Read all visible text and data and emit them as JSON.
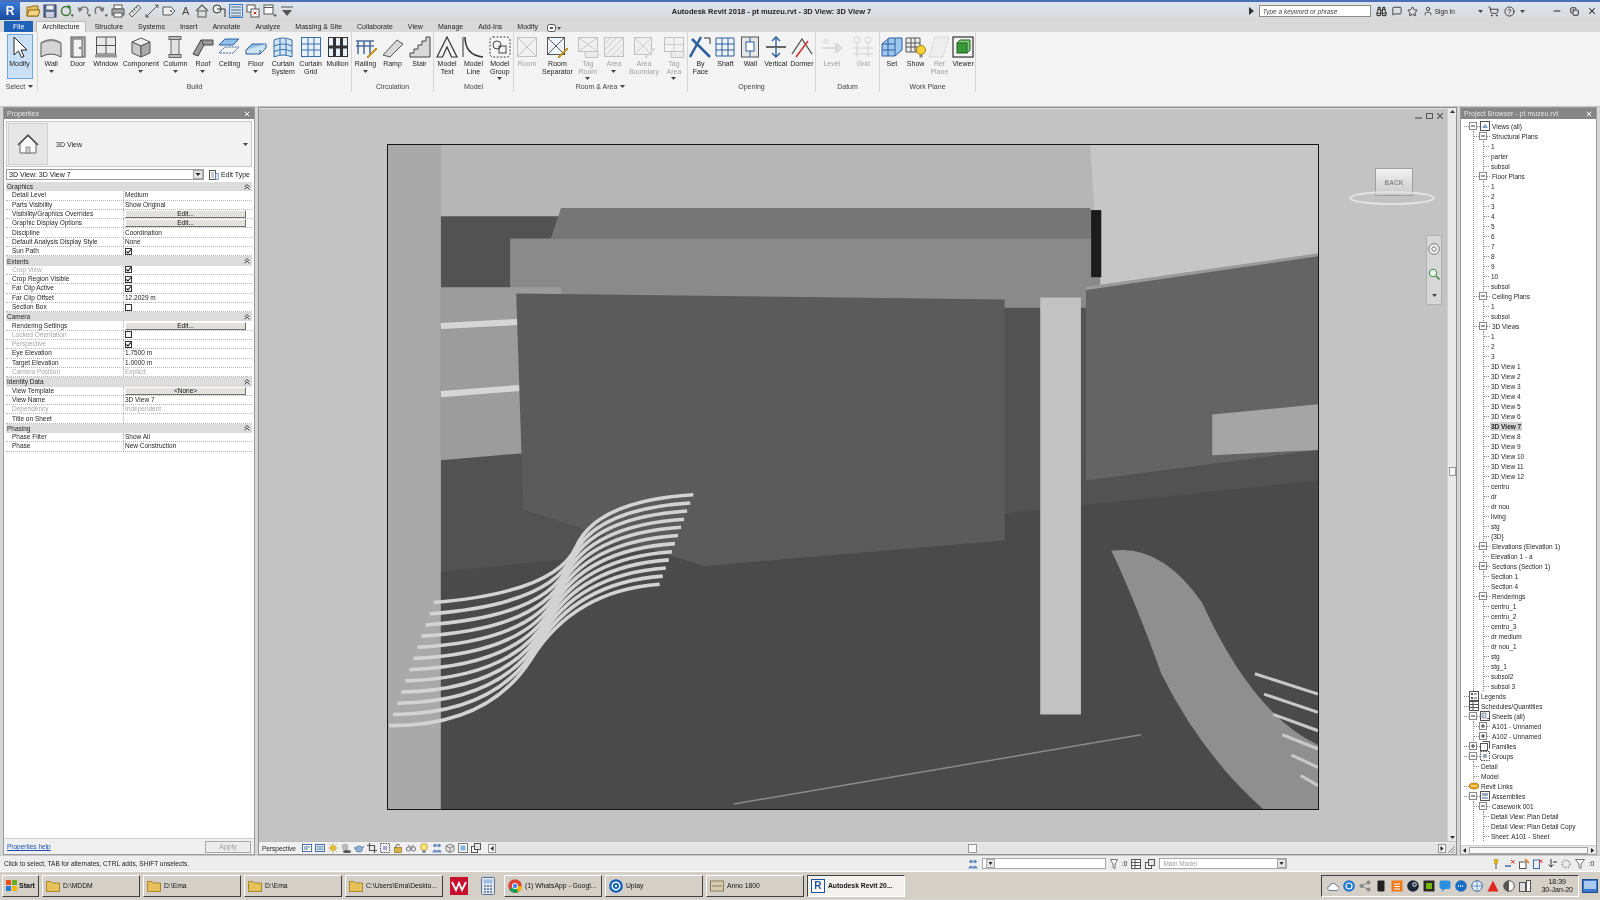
{
  "title_bar": {
    "logo": "R",
    "quick_access": [
      {
        "on": false
      },
      {
        "on": false
      },
      {
        "on": false
      },
      {
        "on": false
      },
      {
        "on": false
      },
      {
        "on": false
      },
      {
        "on": false
      },
      {
        "on": false
      },
      {
        "on": false
      },
      {
        "label": "A",
        "on": false
      },
      {
        "on": false
      },
      {
        "on": false
      },
      {
        "on": true
      },
      {
        "on": false
      },
      {
        "on": false
      },
      {
        "on": false
      }
    ],
    "title": "Autodesk Revit 2018 - pt muzeu.rvt - 3D View: 3D View 7",
    "search": {
      "placeholder": "Type a keyword or phrase"
    },
    "sign_in": "Sign In"
  },
  "ribbon": {
    "tabs": [
      {
        "label": "File",
        "kind": "file",
        "selected": false
      },
      {
        "label": "Architecture",
        "kind": "tab",
        "selected": true
      },
      {
        "label": "Structure",
        "kind": "tab",
        "selected": false
      },
      {
        "label": "Systems",
        "kind": "tab",
        "selected": false
      },
      {
        "label": "Insert",
        "kind": "tab",
        "selected": false
      },
      {
        "label": "Annotate",
        "kind": "tab",
        "selected": false
      },
      {
        "label": "Analyze",
        "kind": "tab",
        "selected": false
      },
      {
        "label": "Massing & Site",
        "kind": "tab",
        "selected": false
      },
      {
        "label": "Collaborate",
        "kind": "tab",
        "selected": false
      },
      {
        "label": "View",
        "kind": "tab",
        "selected": false
      },
      {
        "label": "Manage",
        "kind": "tab",
        "selected": false
      },
      {
        "label": "Add-Ins",
        "kind": "tab",
        "selected": false
      },
      {
        "label": "Modify",
        "kind": "tab",
        "selected": false
      }
    ],
    "panels": [
      {
        "title": "Select",
        "dropdown": true,
        "tools": [
          {
            "label": "Modify",
            "selected": true,
            "disabled": false,
            "dropdown": false
          }
        ]
      },
      {
        "title": "Build",
        "dropdown": false,
        "tools": [
          {
            "label": "Wall",
            "selected": false,
            "disabled": false,
            "dropdown": true
          },
          {
            "label": "Door",
            "selected": false,
            "disabled": false,
            "dropdown": false
          },
          {
            "label": "Window",
            "selected": false,
            "disabled": false,
            "dropdown": false
          },
          {
            "label": "Component",
            "selected": false,
            "disabled": false,
            "dropdown": true
          },
          {
            "label": "Column",
            "selected": false,
            "disabled": false,
            "dropdown": true
          },
          {
            "label": "Roof",
            "selected": false,
            "disabled": false,
            "dropdown": true
          },
          {
            "label": "Ceiling",
            "selected": false,
            "disabled": false,
            "dropdown": false
          },
          {
            "label": "Floor",
            "selected": false,
            "disabled": false,
            "dropdown": true
          },
          {
            "label": "Curtain System",
            "selected": false,
            "disabled": false,
            "dropdown": false
          },
          {
            "label": "Curtain Grid",
            "selected": false,
            "disabled": false,
            "dropdown": false
          },
          {
            "label": "Mullion",
            "selected": false,
            "disabled": false,
            "dropdown": false
          }
        ]
      },
      {
        "title": "Circulation",
        "dropdown": false,
        "tools": [
          {
            "label": "Railing",
            "selected": false,
            "disabled": false,
            "dropdown": true
          },
          {
            "label": "Ramp",
            "selected": false,
            "disabled": false,
            "dropdown": false
          },
          {
            "label": "Stair",
            "selected": false,
            "disabled": false,
            "dropdown": false
          }
        ]
      },
      {
        "title": "Model",
        "dropdown": false,
        "tools": [
          {
            "label": "Model Text",
            "selected": false,
            "disabled": false,
            "dropdown": false
          },
          {
            "label": "Model Line",
            "selected": false,
            "disabled": false,
            "dropdown": false
          },
          {
            "label": "Model Group",
            "selected": false,
            "disabled": false,
            "dropdown": true
          }
        ]
      },
      {
        "title": "Room & Area",
        "dropdown": true,
        "tools": [
          {
            "label": "Room",
            "selected": false,
            "disabled": true,
            "dropdown": false
          },
          {
            "label": "Room Separator",
            "selected": false,
            "disabled": false,
            "dropdown": false
          },
          {
            "label": "Tag Room",
            "selected": false,
            "disabled": true,
            "dropdown": true
          },
          {
            "label": "Area",
            "selected": false,
            "disabled": true,
            "dropdown": true
          },
          {
            "label": "Area Boundary",
            "selected": false,
            "disabled": true,
            "dropdown": false
          },
          {
            "label": "Tag Area",
            "selected": false,
            "disabled": true,
            "dropdown": true
          }
        ]
      },
      {
        "title": "Opening",
        "dropdown": false,
        "tools": [
          {
            "label": "By Face",
            "selected": false,
            "disabled": false,
            "dropdown": false
          },
          {
            "label": "Shaft",
            "selected": false,
            "disabled": false,
            "dropdown": false
          },
          {
            "label": "Wall",
            "selected": false,
            "disabled": false,
            "dropdown": false
          },
          {
            "label": "Vertical",
            "selected": false,
            "disabled": false,
            "dropdown": false
          },
          {
            "label": "Dormer",
            "selected": false,
            "disabled": false,
            "dropdown": false
          }
        ]
      },
      {
        "title": "Datum",
        "dropdown": false,
        "tools": [
          {
            "label": "Level",
            "selected": false,
            "disabled": true,
            "dropdown": false
          },
          {
            "label": "Grid",
            "selected": false,
            "disabled": true,
            "dropdown": false
          }
        ]
      },
      {
        "title": "Work Plane",
        "dropdown": false,
        "tools": [
          {
            "label": "Set",
            "selected": false,
            "disabled": false,
            "dropdown": false
          },
          {
            "label": "Show",
            "selected": false,
            "disabled": false,
            "dropdown": false
          },
          {
            "label": "Ref Plane",
            "selected": false,
            "disabled": true,
            "dropdown": false
          },
          {
            "label": "Viewer",
            "selected": false,
            "disabled": false,
            "dropdown": false
          }
        ]
      }
    ]
  },
  "properties": {
    "title": "Properties",
    "type_name": "3D View",
    "instance": "3D View: 3D View 7",
    "edit_type": "Edit Type",
    "groups": [
      {
        "name": "Graphics",
        "expanded": true,
        "rows": [
          {
            "label": "Detail Level",
            "kind": "text",
            "value": "Medium",
            "disabled": false
          },
          {
            "label": "Parts Visibility",
            "kind": "text",
            "value": "Show Original",
            "disabled": false
          },
          {
            "label": "Visibility/Graphics Overrides",
            "kind": "button",
            "value": "Edit...",
            "disabled": false
          },
          {
            "label": "Graphic Display Options",
            "kind": "button",
            "value": "Edit...",
            "disabled": false
          },
          {
            "label": "Discipline",
            "kind": "text",
            "value": "Coordination",
            "disabled": false
          },
          {
            "label": "Default Analysis Display Style",
            "kind": "text",
            "value": "None",
            "disabled": false
          },
          {
            "label": "Sun Path",
            "kind": "checkbox",
            "checked": true,
            "disabled": false
          }
        ]
      },
      {
        "name": "Extents",
        "expanded": true,
        "rows": [
          {
            "label": "Crop View",
            "kind": "checkbox",
            "checked": true,
            "disabled": true
          },
          {
            "label": "Crop Region Visible",
            "kind": "checkbox",
            "checked": true,
            "disabled": false
          },
          {
            "label": "Far Clip Active",
            "kind": "checkbox",
            "checked": true,
            "disabled": false
          },
          {
            "label": "Far Clip Offset",
            "kind": "text",
            "value": "12.2029 m",
            "disabled": false
          },
          {
            "label": "Section Box",
            "kind": "checkbox",
            "checked": false,
            "disabled": false
          }
        ]
      },
      {
        "name": "Camera",
        "expanded": true,
        "rows": [
          {
            "label": "Rendering Settings",
            "kind": "button",
            "value": "Edit...",
            "disabled": false
          },
          {
            "label": "Locked Orientation",
            "kind": "checkbox",
            "checked": false,
            "disabled": true
          },
          {
            "label": "Perspective",
            "kind": "checkbox",
            "checked": true,
            "disabled": true
          },
          {
            "label": "Eye Elevation",
            "kind": "text",
            "value": "1.7500 m",
            "disabled": false
          },
          {
            "label": "Target Elevation",
            "kind": "text",
            "value": "1.0000 m",
            "disabled": false
          },
          {
            "label": "Camera Position",
            "kind": "text",
            "value": "Explicit",
            "disabled": true
          }
        ]
      },
      {
        "name": "Identity Data",
        "expanded": true,
        "rows": [
          {
            "label": "View Template",
            "kind": "button",
            "value": "<None>",
            "disabled": false
          },
          {
            "label": "View Name",
            "kind": "text",
            "value": "3D View 7",
            "disabled": false
          },
          {
            "label": "Dependency",
            "kind": "text",
            "value": "Independent",
            "disabled": true
          },
          {
            "label": "Title on Sheet",
            "kind": "text",
            "disabled": false
          }
        ]
      },
      {
        "name": "Phasing",
        "expanded": true,
        "rows": [
          {
            "label": "Phase Filter",
            "kind": "text",
            "value": "Show All",
            "disabled": false
          },
          {
            "label": "Phase",
            "kind": "text",
            "value": "New Construction",
            "disabled": false
          }
        ]
      }
    ],
    "help": "Properties help",
    "apply": {
      "label": "Apply",
      "disabled": true
    }
  },
  "view": {
    "view_cube": "BACK",
    "scale": "Perspective"
  },
  "project_browser": {
    "title": "Project Browser - pt muzeu.rvt",
    "tree": [
      {
        "label": "Views (all)",
        "expanded": true,
        "selected": false,
        "children": [
          {
            "label": "Structural Plans",
            "expanded": true,
            "selected": false,
            "children": [
              {
                "label": "1",
                "selected": false
              },
              {
                "label": "parter",
                "selected": false
              },
              {
                "label": "subsol",
                "selected": false
              }
            ]
          },
          {
            "label": "Floor Plans",
            "expanded": true,
            "selected": false,
            "children": [
              {
                "label": "1",
                "selected": false
              },
              {
                "label": "2",
                "selected": false
              },
              {
                "label": "3",
                "selected": false
              },
              {
                "label": "4",
                "selected": false
              },
              {
                "label": "5",
                "selected": false
              },
              {
                "label": "6",
                "selected": false
              },
              {
                "label": "7",
                "selected": false
              },
              {
                "label": "8",
                "selected": false
              },
              {
                "label": "9",
                "selected": false
              },
              {
                "label": "10",
                "selected": false
              },
              {
                "label": "subsol",
                "selected": false
              }
            ]
          },
          {
            "label": "Ceiling Plans",
            "expanded": true,
            "selected": false,
            "children": [
              {
                "label": "1",
                "selected": false
              },
              {
                "label": "subsol",
                "selected": false
              }
            ]
          },
          {
            "label": "3D Views",
            "expanded": true,
            "selected": false,
            "children": [
              {
                "label": "1",
                "selected": false
              },
              {
                "label": "2",
                "selected": false
              },
              {
                "label": "3",
                "selected": false
              },
              {
                "label": "3D View 1",
                "selected": false
              },
              {
                "label": "3D View 2",
                "selected": false
              },
              {
                "label": "3D View 3",
                "selected": false
              },
              {
                "label": "3D View 4",
                "selected": false
              },
              {
                "label": "3D View 5",
                "selected": false
              },
              {
                "label": "3D View 6",
                "selected": false
              },
              {
                "label": "3D View 7",
                "selected": true
              },
              {
                "label": "3D View 8",
                "selected": false
              },
              {
                "label": "3D View 9",
                "selected": false
              },
              {
                "label": "3D View 10",
                "selected": false
              },
              {
                "label": "3D View 11",
                "selected": false
              },
              {
                "label": "3D View 12",
                "selected": false
              },
              {
                "label": "centru",
                "selected": false
              },
              {
                "label": "dr",
                "selected": false
              },
              {
                "label": "dr nou",
                "selected": false
              },
              {
                "label": "living",
                "selected": false
              },
              {
                "label": "stg",
                "selected": false
              },
              {
                "label": "{3D}",
                "selected": false
              }
            ]
          },
          {
            "label": "Elevations (Elevation 1)",
            "expanded": true,
            "selected": false,
            "children": [
              {
                "label": "Elevation 1 - a",
                "selected": false
              }
            ]
          },
          {
            "label": "Sections (Section 1)",
            "expanded": true,
            "selected": false,
            "children": [
              {
                "label": "Section 1",
                "selected": false
              },
              {
                "label": "Section 4",
                "selected": false
              }
            ]
          },
          {
            "label": "Renderings",
            "expanded": true,
            "selected": false,
            "children": [
              {
                "label": "centru_1",
                "selected": false
              },
              {
                "label": "centru_2",
                "selected": false
              },
              {
                "label": "centru_3",
                "selected": false
              },
              {
                "label": "dr medium",
                "selected": false
              },
              {
                "label": "dr nou_1",
                "selected": false
              },
              {
                "label": "stg",
                "selected": false
              },
              {
                "label": "stg_1",
                "selected": false
              },
              {
                "label": "subsol2",
                "selected": false
              },
              {
                "label": "subsol 3",
                "selected": false
              }
            ]
          }
        ]
      },
      {
        "label": "Legends",
        "selected": false
      },
      {
        "label": "Schedules/Quantities",
        "selected": false
      },
      {
        "label": "Sheets (all)",
        "expanded": true,
        "selected": false,
        "children": [
          {
            "label": "A101 - Unnamed",
            "expanded": false,
            "selected": false
          },
          {
            "label": "A102 - Unnamed",
            "expanded": false,
            "selected": false
          }
        ]
      },
      {
        "label": "Families",
        "expanded": false,
        "selected": false
      },
      {
        "label": "Groups",
        "expanded": true,
        "selected": false,
        "children": [
          {
            "label": "Detail",
            "selected": false
          },
          {
            "label": "Model",
            "selected": false
          }
        ]
      },
      {
        "label": "Revit Links",
        "selected": false
      },
      {
        "label": "Assemblies",
        "expanded": true,
        "selected": false,
        "children": [
          {
            "label": "Casework 001",
            "expanded": true,
            "selected": false,
            "children": [
              {
                "label": "Detail View: Plan Detail",
                "selected": false
              },
              {
                "label": "Detail View: Plan Detail Copy",
                "selected": false
              },
              {
                "label": "Sheet: A101 - Sheet",
                "selected": false
              }
            ]
          }
        ]
      }
    ]
  },
  "status_bar": {
    "message": "Click to select, TAB for alternates, CTRL adds, SHIFT unselects.",
    "selection_count": ":0",
    "design_option": {
      "value": "Main Model",
      "disabled": true
    },
    "filter_count": ":0"
  },
  "taskbar": {
    "start": "Start",
    "items": [
      {
        "label": "D:\\MDDM",
        "selected": false
      },
      {
        "label": "D:\\Ema",
        "selected": false
      },
      {
        "label": "D:\\Ema",
        "selected": false
      },
      {
        "label": "C:\\Users\\Ema\\Deskto...",
        "selected": false
      },
      {
        "selected": false
      },
      {
        "selected": false
      },
      {
        "label": "(1) WhatsApp - Googl...",
        "selected": false
      },
      {
        "label": "Uplay",
        "selected": false
      },
      {
        "label": "Anno 1800",
        "selected": false
      },
      {
        "label": "Autodesk Revit 20...",
        "icon_letter": "R",
        "selected": true
      }
    ],
    "clock": {
      "time": "18:39",
      "date": "30-Jan-20"
    }
  }
}
